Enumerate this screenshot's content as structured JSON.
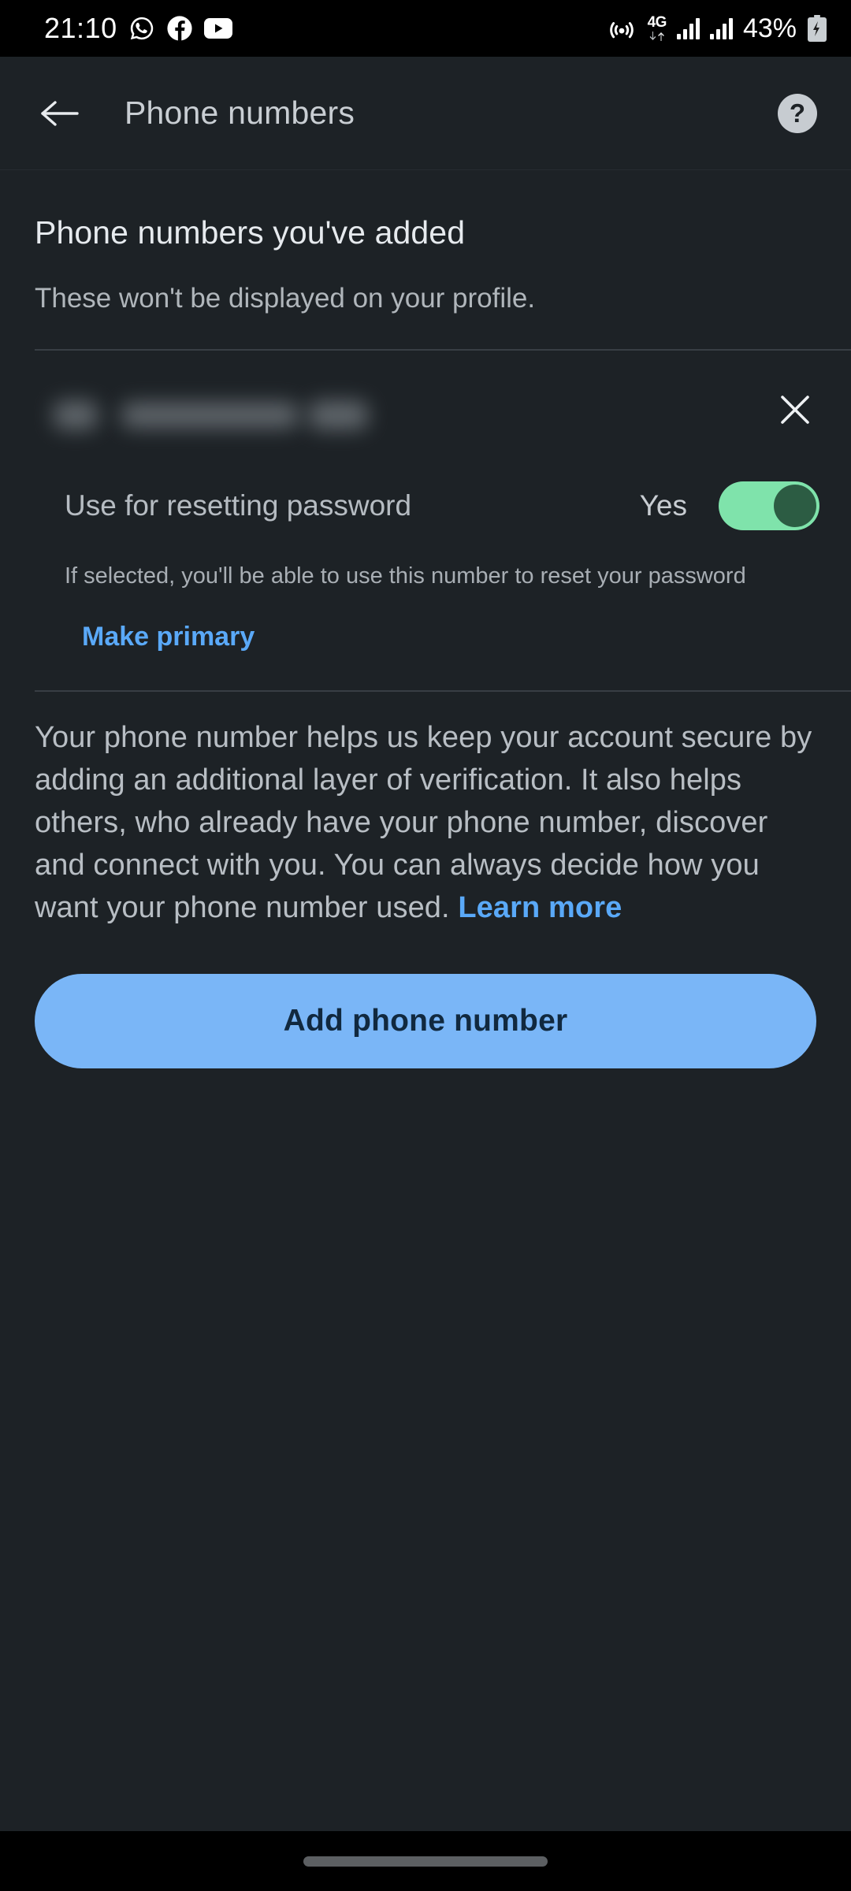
{
  "status_bar": {
    "time": "21:10",
    "left_icons": [
      "whatsapp-icon",
      "facebook-icon",
      "youtube-icon"
    ],
    "hotspot_icon": "hotspot-icon",
    "network_type": "4G",
    "battery_percent": "43%",
    "battery_state": "charging",
    "signal_bars": 4,
    "signal_bars_secondary": 3
  },
  "app_bar": {
    "back_label": "back-arrow",
    "title": "Phone numbers",
    "help_label": "?"
  },
  "main": {
    "section_title": "Phone numbers you've added",
    "section_subtitle": "These won't be displayed on your profile.",
    "number_entry": {
      "number_redacted": "",
      "close_label": "×",
      "toggle_label": "Use for resetting password",
      "toggle_value": "Yes",
      "toggle_on": true,
      "helper_text": "If selected, you'll be able to use this number to reset your password",
      "make_primary_label": "Make primary"
    },
    "description_text": "Your phone number helps us keep your account secure by adding an additional layer of verification. It also helps others, who already have your phone number, discover and connect with you. You can always decide how you want your phone number used. ",
    "description_link": "Learn more",
    "add_button_label": "Add phone number"
  },
  "colors": {
    "background": "#1d2226",
    "status_bar_bg": "#000000",
    "accent_link": "#5aa9f8",
    "button_bg": "#7ab6f7",
    "button_text": "#11293f",
    "toggle_track": "#7fe3ab",
    "toggle_knob": "#2c5c43",
    "divider": "#383e44",
    "title_text": "#c9ced3",
    "body_text": "#b8bec4"
  }
}
